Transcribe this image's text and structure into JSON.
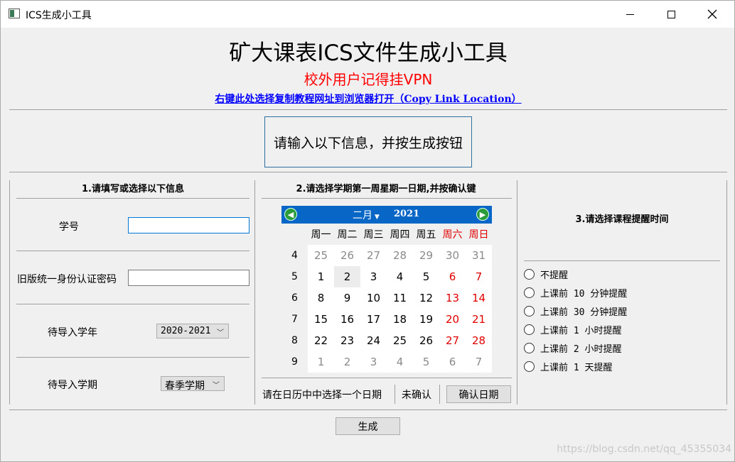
{
  "window": {
    "title": "ICS生成小工具"
  },
  "header": {
    "title": "矿大课表ICS文件生成小工具",
    "subtitle": "校外用户记得挂VPN",
    "link": "右键此处选择复制教程网址到浏览器打开（Copy Link Location）"
  },
  "prompt": "请输入以下信息，并按生成按钮",
  "section1": {
    "title": "1.请填写或选择以下信息",
    "student_id_label": "学号",
    "student_id_value": "",
    "password_label": "旧版统一身份认证密码",
    "password_value": "",
    "year_label": "待导入学年",
    "year_value": "2020-2021",
    "term_label": "待导入学期",
    "term_value": "春季学期"
  },
  "section2": {
    "title": "2.请选择学期第一周星期一日期,并按确认键",
    "calendar": {
      "month": "二月",
      "year": "2021",
      "weekdays": [
        "周一",
        "周二",
        "周三",
        "周四",
        "周五",
        "周六",
        "周日"
      ],
      "weeks": [
        {
          "num": "4",
          "days": [
            "25",
            "26",
            "27",
            "28",
            "29",
            "30",
            "31"
          ]
        },
        {
          "num": "5",
          "days": [
            "1",
            "2",
            "3",
            "4",
            "5",
            "6",
            "7"
          ]
        },
        {
          "num": "6",
          "days": [
            "8",
            "9",
            "10",
            "11",
            "12",
            "13",
            "14"
          ]
        },
        {
          "num": "7",
          "days": [
            "15",
            "16",
            "17",
            "18",
            "19",
            "20",
            "21"
          ]
        },
        {
          "num": "8",
          "days": [
            "22",
            "23",
            "24",
            "25",
            "26",
            "27",
            "28"
          ]
        },
        {
          "num": "9",
          "days": [
            "1",
            "2",
            "3",
            "4",
            "5",
            "6",
            "7"
          ]
        }
      ],
      "selected": "2"
    },
    "hint": "请在日历中中选择一个日期",
    "status": "未确认",
    "confirm_button": "确认日期"
  },
  "section3": {
    "title": "3.请选择课程提醒时间",
    "options": [
      "不提醒",
      "上课前 10 分钟提醒",
      "上课前 30 分钟提醒",
      "上课前 1 小时提醒",
      "上课前 2 小时提醒",
      "上课前 1 天提醒"
    ]
  },
  "generate_button": "生成",
  "watermark": "https://blog.csdn.net/qq_45355034"
}
